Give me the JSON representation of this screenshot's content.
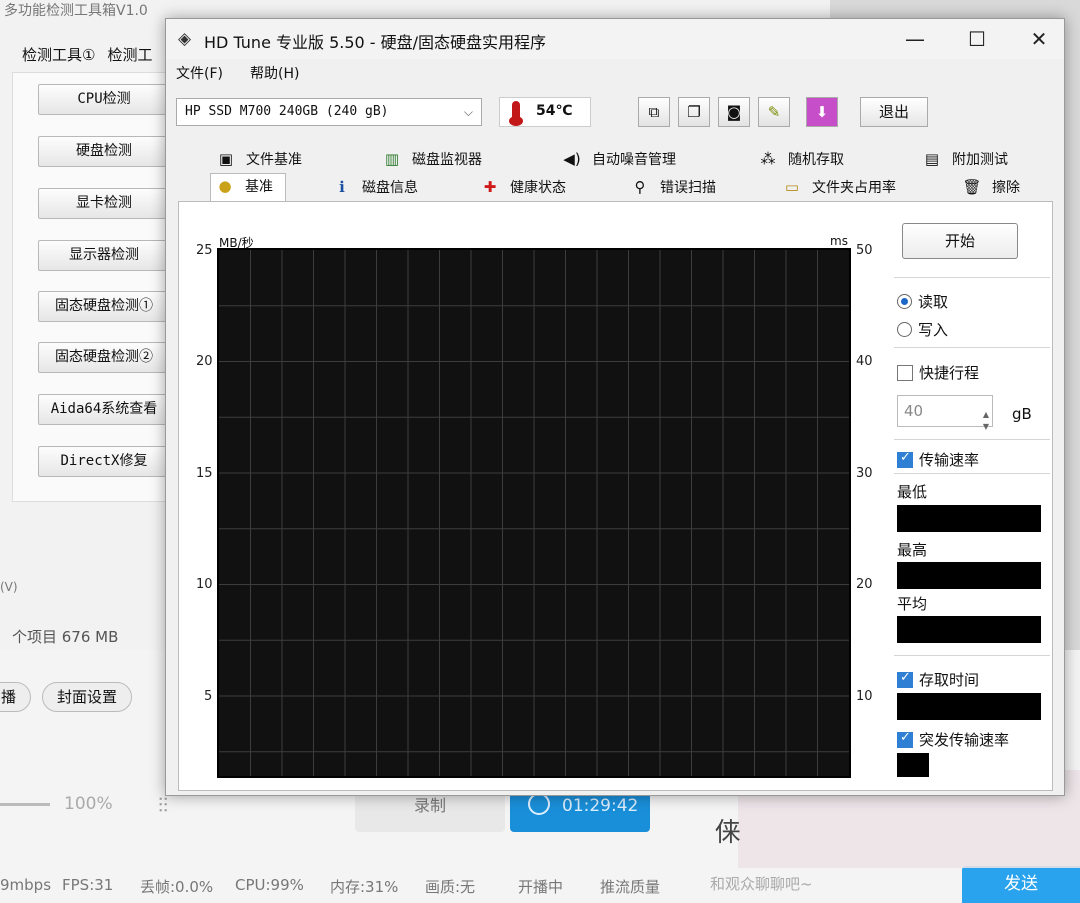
{
  "background_app": {
    "title": "多功能检测工具箱V1.0",
    "tabs": [
      "检测工具①",
      "检测工"
    ],
    "buttons": [
      "CPU检测",
      "硬盘检测",
      "显卡检测",
      "显示器检测",
      "固态硬盘检测①",
      "固态硬盘检测②",
      "Aida64系统查看",
      "DirectX修复"
    ],
    "status_partial": "(V)",
    "items_text": "个项目 676 MB"
  },
  "stream_app": {
    "pills": [
      "播",
      "封面设置"
    ],
    "volume_label": "100%",
    "record_label": "录制",
    "timer": "01:29:42",
    "status": [
      "9mbps",
      "FPS:31",
      "丢帧:0.0%",
      "CPU:99%",
      "内存:31%",
      "画质:无",
      "开播中",
      "推流质量"
    ],
    "chat_placeholder": "和观众聊聊吧~",
    "send_label": "发送",
    "overlay_char": "俫"
  },
  "window": {
    "title": "HD Tune 专业版 5.50 - 硬盘/固态硬盘实用程序",
    "controls": {
      "minimize": "—",
      "maximize": "☐",
      "close": "✕"
    },
    "menu": [
      "文件(F)",
      "帮助(H)"
    ],
    "drive": "HP SSD M700 240GB (240 gB)",
    "temperature": "54℃",
    "exit_label": "退出",
    "tabs_row1": [
      "文件基准",
      "磁盘监视器",
      "自动噪音管理",
      "随机存取",
      "附加测试"
    ],
    "tabs_row2": [
      "基准",
      "磁盘信息",
      "健康状态",
      "错误扫描",
      "文件夹占用率",
      "擦除"
    ]
  },
  "graph": {
    "left_unit": "MB/秒",
    "right_unit": "ms",
    "left_ticks": [
      "25",
      "20",
      "15",
      "10",
      "5"
    ],
    "right_ticks": [
      "50",
      "40",
      "30",
      "20",
      "10"
    ]
  },
  "panel": {
    "start_label": "开始",
    "read_label": "读取",
    "write_label": "写入",
    "short_stroke_label": "快捷行程",
    "stroke_value": "40",
    "stroke_unit": "gB",
    "transfer_rate_label": "传输速率",
    "min_label": "最低",
    "max_label": "最高",
    "avg_label": "平均",
    "access_time_label": "存取时间",
    "burst_rate_label": "突发传输速率"
  }
}
